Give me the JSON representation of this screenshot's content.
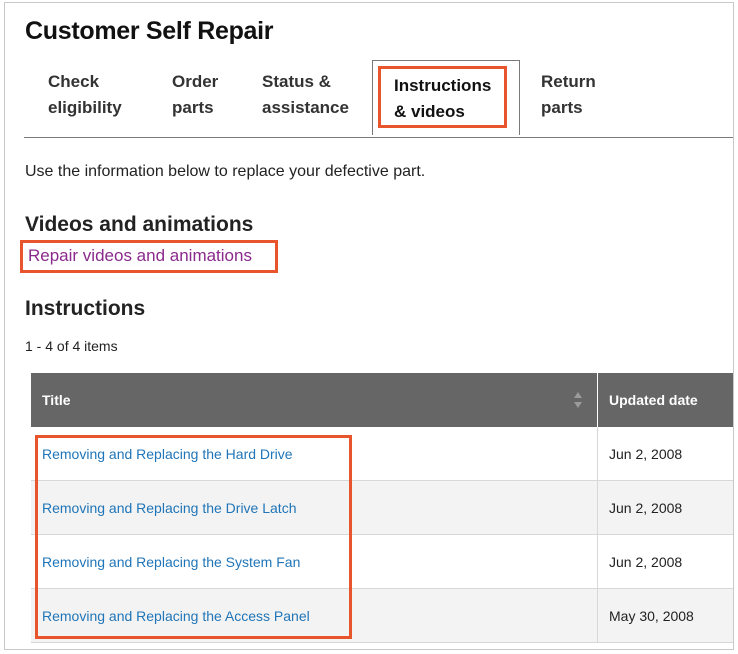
{
  "page": {
    "title": "Customer Self Repair",
    "intro": "Use the information below to replace your defective part."
  },
  "tabs": [
    {
      "line1": "Check",
      "line2": "eligibility",
      "active": false
    },
    {
      "line1": "Order",
      "line2": "parts",
      "active": false
    },
    {
      "line1": "Status &",
      "line2": "assistance",
      "active": false
    },
    {
      "line1": "Instructions",
      "line2": "& videos",
      "active": true
    },
    {
      "line1": "Return",
      "line2": "parts",
      "active": false
    }
  ],
  "videos": {
    "heading": "Videos and animations",
    "link": "Repair videos and animations"
  },
  "instructions": {
    "heading": "Instructions",
    "count": "1 - 4 of 4 items",
    "columns": {
      "title": "Title",
      "date": "Updated date"
    },
    "rows": [
      {
        "title": "Removing and Replacing the Hard Drive",
        "date": "Jun 2, 2008"
      },
      {
        "title": "Removing and Replacing the Drive Latch",
        "date": "Jun 2, 2008"
      },
      {
        "title": "Removing and Replacing the System Fan",
        "date": "Jun 2, 2008"
      },
      {
        "title": "Removing and Replacing the Access Panel",
        "date": "May 30, 2008"
      }
    ]
  },
  "colors": {
    "highlight": "#e8542b",
    "link_blue": "#1f75b8",
    "visited_link": "#8a2a8c",
    "table_header": "#666666"
  },
  "icons": {
    "sort": "sort-icon"
  }
}
